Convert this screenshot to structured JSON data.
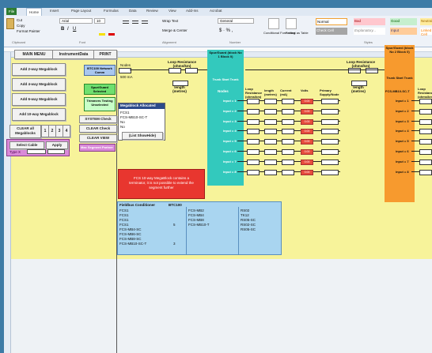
{
  "ribbon": {
    "tabs": [
      "File",
      "Home",
      "Insert",
      "Page Layout",
      "Formulas",
      "Data",
      "Review",
      "View",
      "Add-Ins",
      "Acrobat"
    ],
    "clipboard": {
      "cut": "Cut",
      "copy": "Copy",
      "format_painter": "Format Painter",
      "group": "Clipboard"
    },
    "font": {
      "name": "Arial",
      "size": "10",
      "group": "Font"
    },
    "alignment": {
      "wrap": "Wrap Text",
      "merge": "Merge & Center",
      "group": "Alignment"
    },
    "number": {
      "format": "General",
      "group": "Number"
    },
    "styles": {
      "conditional": "Conditional Formatting",
      "table": "Format as Table",
      "normal": "Normal",
      "bad": "Bad",
      "good": "Good",
      "neutral": "Neutral",
      "check_cell": "Check Cell",
      "explanatory": "Explanatory...",
      "input": "Input",
      "linked": "Linked Cell",
      "group": "Styles"
    }
  },
  "controls": {
    "main_menu": "MAIN MENU",
    "instrument_data": "InstrumentData",
    "print": "PRINT",
    "add2": "Add 2-way Megablock",
    "add4": "Add 4-way Megablock",
    "add6": "Add 6-way Megablock",
    "add10": "Add 10-way Megablock",
    "clear_all": "CLEAR all Megablocks",
    "nums": [
      "1",
      "2",
      "3",
      "4"
    ],
    "select_cable": "Select Cable",
    "apply": "Apply",
    "type_label": "Type X"
  },
  "network": {
    "btn1": "BTC100 Network Comm",
    "spur": "Spur/Guard Selected",
    "trunk": "Trimmers Testing Unselected",
    "sys_check": "SYSTEM Check",
    "clear_check": "CLEAR Check",
    "clear_view": "CLEAR VIEW",
    "mega_title": "Megablock Allocated",
    "mega_items": [
      "FCS1",
      "FCS-MB10-SC-T",
      "No",
      "No"
    ],
    "list_btn": "(List ShowHide)",
    "pink_title": "Max Segment Partner"
  },
  "warning": "FCS 10-way MegaBlock contains a terminator, it is not possible to extend the segment further",
  "table": {
    "headers": [
      "Fieldbus Conditioner",
      "BTC100"
    ],
    "col1": [
      "FCS1",
      "FCS1",
      "FCS1",
      "FCS1",
      "FCS-MB4-SC",
      "FCS-MB6-SC",
      "FCS-MB8-SC",
      "FCS-MB10-SC-T"
    ],
    "col2": [
      "",
      "",
      "",
      "5",
      "",
      "",
      "",
      "3"
    ],
    "col3": [
      "FCS-MB2",
      "FCS-MB4",
      "FCS-MB8",
      "FCS-MB10-T"
    ],
    "col4": [
      "RS02",
      "TK12",
      "RS05-SC",
      "RS02-SC",
      "RS05-SC"
    ]
  },
  "segment": {
    "nodes": "Nodes",
    "loop": "Loop Resistance (ohms/km)",
    "length": "length (metres)",
    "spur_header": "Spur/Guard (block No 1 Block 0)",
    "spur_header2": "Spur/Guard (block No 2 Block 0)",
    "trunk_start": "Trunk Start Trunk",
    "loop_res": "Loop Resistance (ohms/km)",
    "length2": "length (metres)",
    "current": "Current (mA)",
    "volts": "Volts",
    "power": "Primary Supply/Node",
    "input_rows": [
      "input = 1",
      "input = 2",
      "input = 3",
      "input = 4",
      "input = 5",
      "input = 6",
      "input = 7",
      "input = 8"
    ],
    "mb": "FCS-MB10-SC-T",
    "value": "100",
    "side_val": "500 mA",
    "red_val": "0.00"
  },
  "colors": {
    "yellow": "#f7f39a",
    "teal": "#33c9bd",
    "orange": "#f79a2e",
    "red": "#e8362f",
    "blue_table": "#a9d5f0"
  }
}
